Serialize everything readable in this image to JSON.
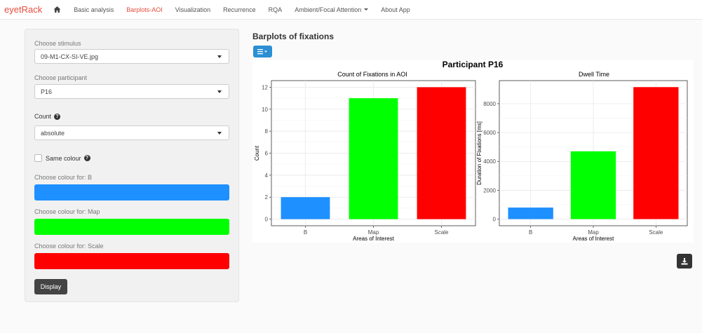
{
  "navbar": {
    "brand": "eyetRack",
    "items": [
      {
        "label": "Basic analysis"
      },
      {
        "label": "Barplots-AOI",
        "active": true
      },
      {
        "label": "Visualization"
      },
      {
        "label": "Recurrence"
      },
      {
        "label": "RQA"
      },
      {
        "label": "Ambient/Focal Attention"
      },
      {
        "label": "About App"
      }
    ]
  },
  "sidebar": {
    "stimulus_label": "Choose stimulus",
    "stimulus_value": "09-M1-CX-SI-VE.jpg",
    "participant_label": "Choose participant",
    "participant_value": "P16",
    "count_label": "Count",
    "count_value": "absolute",
    "same_colour_label": "Same colour",
    "colour_b_label": "Choose colour for: B",
    "colour_map_label": "Choose colour for: Map",
    "colour_scale_label": "Choose colour for: Scale",
    "display_button": "Display"
  },
  "colors": {
    "brand": "#e74c3c",
    "B": "#1e90ff",
    "Map": "#00ff00",
    "Scale": "#ff0000"
  },
  "main": {
    "title": "Barplots of fixations"
  },
  "chart_data": [
    {
      "type": "bar",
      "suptitle": "Participant P16",
      "title": "Count of Fixations in AOI",
      "xlabel": "Areas of Interest",
      "ylabel": "Count",
      "categories": [
        "B",
        "Map",
        "Scale"
      ],
      "values": [
        2,
        11,
        12
      ],
      "colors": [
        "#1e90ff",
        "#00ff00",
        "#ff0000"
      ],
      "ylim": [
        -0.6,
        12.6
      ],
      "yticks": [
        0,
        2,
        4,
        6,
        8,
        10,
        12
      ],
      "grid": true
    },
    {
      "type": "bar",
      "title": "Dwell Time",
      "xlabel": "Areas of Interest",
      "ylabel": "Duration of Fixations [ms]",
      "categories": [
        "B",
        "Map",
        "Scale"
      ],
      "values": [
        800,
        4700,
        9150
      ],
      "colors": [
        "#1e90ff",
        "#00ff00",
        "#ff0000"
      ],
      "ylim": [
        -460,
        9600
      ],
      "yticks": [
        0,
        2000,
        4000,
        6000,
        8000
      ],
      "grid": true
    }
  ]
}
